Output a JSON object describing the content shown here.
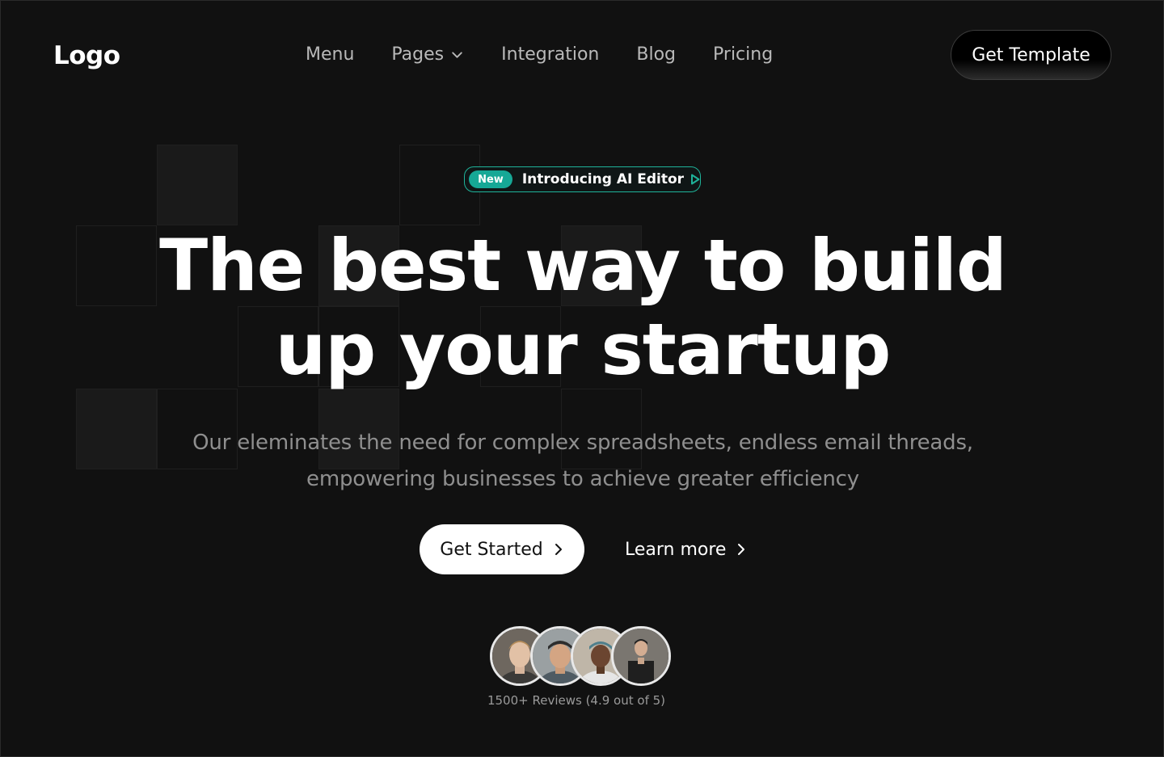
{
  "header": {
    "logo": "Logo",
    "nav": [
      {
        "label": "Menu"
      },
      {
        "label": "Pages",
        "has_dropdown": true
      },
      {
        "label": "Integration"
      },
      {
        "label": "Blog"
      },
      {
        "label": "Pricing"
      }
    ],
    "cta_label": "Get Template"
  },
  "badge": {
    "tag": "New",
    "text": "Introducing AI Editor",
    "accent": "#16a896"
  },
  "hero": {
    "headline_line1": "The best way to build",
    "headline_line2": "up your startup",
    "sub_line1": "Our eleminates the need for complex spreadsheets, endless email threads,",
    "sub_line2": "empowering businesses to achieve greater efficiency",
    "primary_cta": "Get Started",
    "secondary_cta": "Learn more"
  },
  "social_proof": {
    "avatars": [
      {
        "icon": "person-avatar-1"
      },
      {
        "icon": "person-avatar-2"
      },
      {
        "icon": "person-avatar-3"
      },
      {
        "icon": "person-avatar-4"
      }
    ],
    "reviews_text": "1500+ Reviews (4.9 out of 5)"
  },
  "colors": {
    "background": "#111111",
    "text": "#ffffff",
    "muted": "#8f8f8f"
  }
}
